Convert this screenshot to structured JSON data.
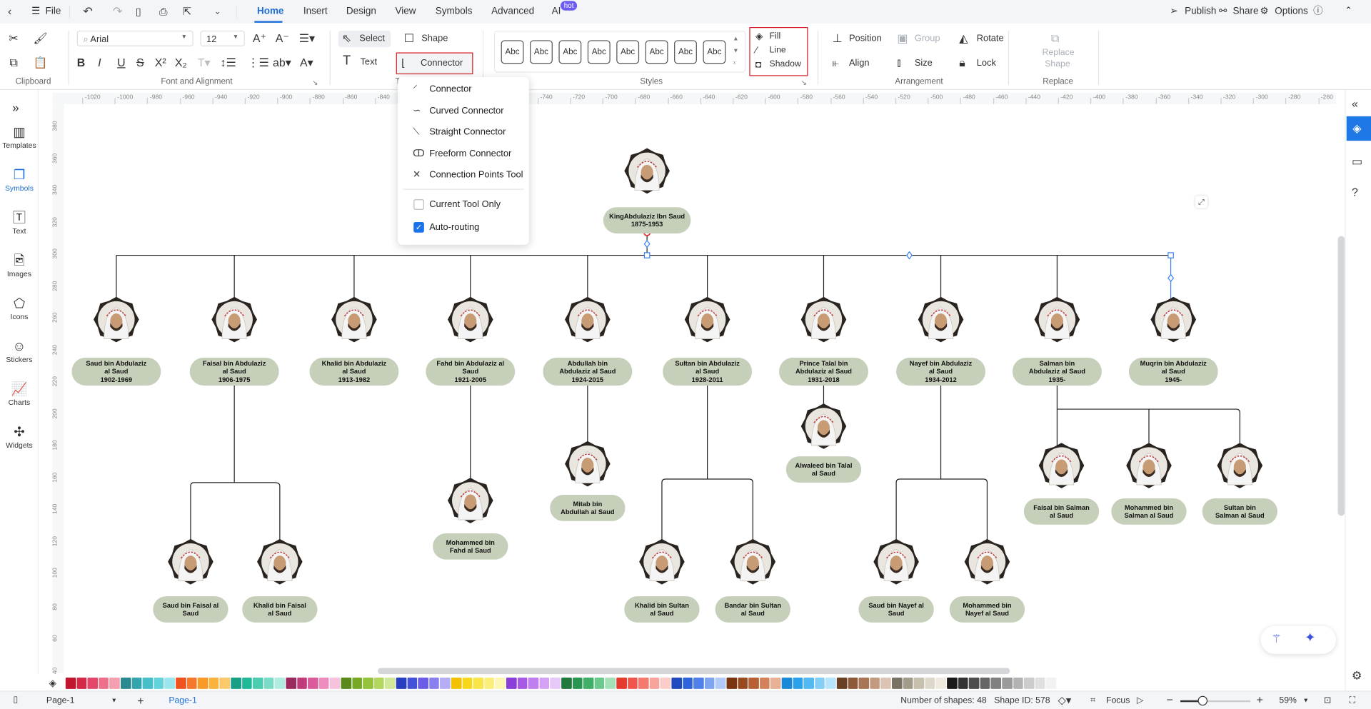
{
  "topbar": {
    "file": "File",
    "tabs": [
      "Home",
      "Insert",
      "Design",
      "View",
      "Symbols",
      "Advanced",
      "AI"
    ],
    "ai_badge": "hot",
    "active_tab": "Home",
    "publish": "Publish",
    "share": "Share",
    "options": "Options"
  },
  "ribbon": {
    "clipboard_label": "Clipboard",
    "font_name": "Arial",
    "font_size": "12",
    "font_label": "Font and Alignment",
    "select": "Select",
    "shape": "Shape",
    "text": "Text",
    "connector": "Connector",
    "tools_label": "T",
    "style_buttons": [
      "Abc",
      "Abc",
      "Abc",
      "Abc",
      "Abc",
      "Abc",
      "Abc",
      "Abc"
    ],
    "styles_label": "Styles",
    "fill": "Fill",
    "line": "Line",
    "shadow": "Shadow",
    "position": "Position",
    "group": "Group",
    "rotate": "Rotate",
    "align": "Align",
    "size": "Size",
    "lock": "Lock",
    "arrangement_label": "Arrangement",
    "replace_shape": [
      "Replace",
      "Shape"
    ],
    "replace_label": "Replace"
  },
  "connector_menu": {
    "items": [
      {
        "label": "Connector",
        "icon": "elbow-connector-icon"
      },
      {
        "label": "Curved Connector",
        "icon": "curved-connector-icon"
      },
      {
        "label": "Straight Connector",
        "icon": "straight-connector-icon"
      },
      {
        "label": "Freeform Connector",
        "icon": "freeform-connector-icon"
      },
      {
        "label": "Connection Points Tool",
        "icon": "connection-points-icon"
      }
    ],
    "options": [
      {
        "label": "Current Tool Only",
        "checked": false
      },
      {
        "label": "Auto-routing",
        "checked": true
      }
    ]
  },
  "sidebar": {
    "items": [
      "Templates",
      "Symbols",
      "Text",
      "Images",
      "Icons",
      "Stickers",
      "Charts",
      "Widgets"
    ],
    "active": "Symbols"
  },
  "ruler": {
    "h_start": -1020,
    "h_end": -240,
    "v_start": 380,
    "v_end": 40,
    "step": 20
  },
  "tree": {
    "nodes": [
      {
        "lines": [
          "KingAbdulaziz Ibn Saud",
          "1875-1953"
        ]
      },
      {
        "lines": [
          "Saud bin Abdulaziz",
          "al Saud",
          "1902-1969"
        ]
      },
      {
        "lines": [
          "Faisal bin Abdulaziz",
          "al Saud",
          "1906-1975"
        ]
      },
      {
        "lines": [
          "Khalid bin Abdulaziz",
          "al Saud",
          "1913-1982"
        ]
      },
      {
        "lines": [
          "Fahd bin Abdulaziz al",
          "Saud",
          "1921-2005"
        ]
      },
      {
        "lines": [
          "Abdullah bin",
          "Abdulaziz al Saud",
          "1924-2015"
        ]
      },
      {
        "lines": [
          "Sultan bin Abdulaziz",
          "al Saud",
          "1928-2011"
        ]
      },
      {
        "lines": [
          "Prince Talal bin",
          "Abdulaziz al Saud",
          "1931-2018"
        ]
      },
      {
        "lines": [
          "Nayef bin Abdulaziz",
          "al Saud",
          "1934-2012"
        ]
      },
      {
        "lines": [
          "Salman bin",
          "Abdulaziz al Saud",
          "1935-"
        ]
      },
      {
        "lines": [
          "Muqrin bin Abdulaziz",
          "al Saud",
          "1945-"
        ]
      },
      {
        "lines": [
          "Saud bin Faisal al",
          "Saud"
        ]
      },
      {
        "lines": [
          "Khalid bin Faisal",
          "al Saud"
        ]
      },
      {
        "lines": [
          "Mohammed bin",
          "Fahd al Saud"
        ]
      },
      {
        "lines": [
          "Mitab bin",
          "Abdullah al Saud"
        ]
      },
      {
        "lines": [
          "Alwaleed bin Talal",
          "al Saud"
        ]
      },
      {
        "lines": [
          "Khalid bin Sultan",
          "al Saud"
        ]
      },
      {
        "lines": [
          "Bandar bin Sultan",
          "al Saud"
        ]
      },
      {
        "lines": [
          "Saud bin Nayef al",
          "Saud"
        ]
      },
      {
        "lines": [
          "Mohammed bin",
          "Nayef al Saud"
        ]
      },
      {
        "lines": [
          "Faisal bin Salman",
          "al Saud"
        ]
      },
      {
        "lines": [
          "Mohammed bin",
          "Salman al Saud"
        ]
      },
      {
        "lines": [
          "Sultan bin",
          "Salman al Saud"
        ]
      }
    ],
    "pill_color": "#c6cfba"
  },
  "palette": [
    "#c0172e",
    "#d42a48",
    "#e4476a",
    "#ee6f8a",
    "#f59fb0",
    "#2a8a8f",
    "#35a5ad",
    "#46bfc8",
    "#62d3db",
    "#9be6ec",
    "#f0531e",
    "#f6782c",
    "#f99a26",
    "#fbb33b",
    "#fcc96a",
    "#17a086",
    "#1fb998",
    "#4cccb0",
    "#7adcc7",
    "#b2ece0",
    "#9c2a5e",
    "#c03b7a",
    "#dc5c9b",
    "#ee8cbe",
    "#f7c2dc",
    "#5a8a1c",
    "#76a823",
    "#94c23a",
    "#b2d65e",
    "#d0e79a",
    "#2a3fbf",
    "#4452d8",
    "#6a5ce6",
    "#8a7ff0",
    "#b5aef7",
    "#f2c200",
    "#f7d71c",
    "#f9e449",
    "#fbee7b",
    "#fdf6b4",
    "#8a3fd8",
    "#a65ae6",
    "#c07ef0",
    "#d6a2f5",
    "#e8c8f9",
    "#207a3e",
    "#2a9550",
    "#3fae67",
    "#6cc88d",
    "#a5e0b9",
    "#e53a2e",
    "#f0564b",
    "#f47a70",
    "#f8a39c",
    "#fbcdc9",
    "#1f4bbf",
    "#2f63d9",
    "#4f80ea",
    "#7fa4f2",
    "#b3caf8",
    "#7a3510",
    "#9a4a1f",
    "#b85f34",
    "#d3825c",
    "#e8b094",
    "#1989d8",
    "#2aa1ea",
    "#52b9f2",
    "#83cff7",
    "#b8e4fb",
    "#6a4024",
    "#8c5a3a",
    "#a87556",
    "#c29a80",
    "#dcc3b3",
    "#7a7263",
    "#a39b8a",
    "#c7c0af",
    "#ddd8cb",
    "#efeadf",
    "#1a1a1a",
    "#333333",
    "#4d4d4d",
    "#666666",
    "#808080",
    "#9a9a9a",
    "#b3b3b3",
    "#cccccc",
    "#e0e0e0",
    "#f2f2f2"
  ],
  "status": {
    "page_selector": "Page-1",
    "page_tab": "Page-1",
    "shapes": "Number of shapes: 48",
    "shape_id": "Shape ID: 578",
    "focus": "Focus",
    "zoom": "59%",
    "zoom_level": 59
  }
}
